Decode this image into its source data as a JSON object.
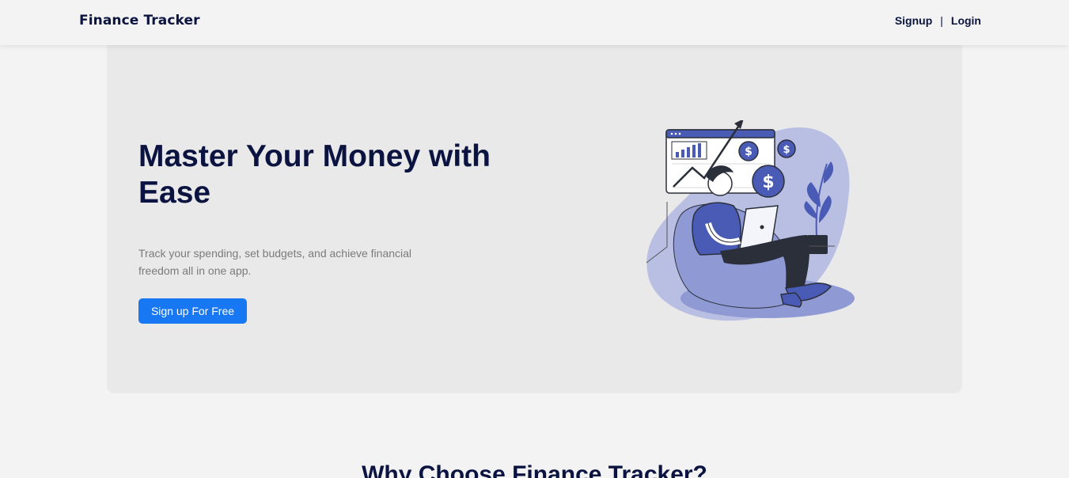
{
  "nav": {
    "brand": "Finance Tracker",
    "signup": "Signup",
    "separator": "|",
    "login": "Login"
  },
  "hero": {
    "title": "Master Your Money with Ease",
    "subtitle": "Track your spending, set budgets, and achieve financial freedom all in one app.",
    "cta": "Sign up For Free",
    "illustration": "man-on-beanbag-with-laptop-finance-illustration"
  },
  "features": {
    "heading": "Why Choose Finance Tracker?"
  },
  "colors": {
    "background": "#f3f3f3",
    "hero_background": "#e9e9e9",
    "heading_text": "#0b1440",
    "muted_text": "#7b7b7b",
    "primary_button": "#1877f2",
    "illustration_accent": "#4a5bb5"
  }
}
